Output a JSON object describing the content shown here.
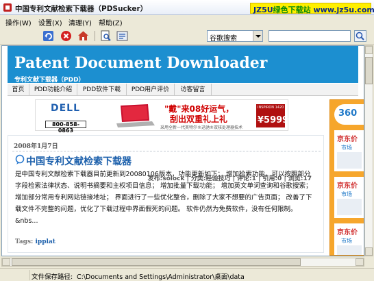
{
  "window": {
    "title": "中国专利文献检索下载器（PDSucker）",
    "watermark_prefix": "JZ5U",
    "watermark_green": "绿色下载站",
    "watermark_url": "www.jz5u.com"
  },
  "menu": [
    {
      "label": "操作(W)"
    },
    {
      "label": "设置(X)"
    },
    {
      "label": "清理(Y)"
    },
    {
      "label": "帮助(Z)"
    }
  ],
  "toolbar": {
    "buttons": [
      {
        "icon": "refresh-icon"
      },
      {
        "icon": "stop-icon"
      },
      {
        "icon": "home-icon"
      },
      {
        "icon": "search-page-icon"
      },
      {
        "icon": "zoom-icon"
      }
    ],
    "search_engine": "谷歌搜索",
    "search_value": "",
    "go_icon": "search-go-icon"
  },
  "page": {
    "site_title": "Patent Document Downloader",
    "site_subtitle": "专利文献下载器（PDD）",
    "nav": [
      "首页",
      "PDD功能介绍",
      "PDD软件下载",
      "PDD用户评价",
      "访客留言"
    ],
    "banner_ad": {
      "brand": "DELL",
      "phone": "800-858-0863",
      "line1": "\"戴\"来08好运气，",
      "line2": "刮出双重礼上礼",
      "line3": "采用全新一代英特尔®迅驰®双核处理器技术",
      "price_tag": "INSPIRON 1420",
      "price": "¥5999"
    },
    "post": {
      "date": "2008年1月7日",
      "title": "中国专利文献检索下载器",
      "body": "是中国专利文献检索下载器目前更新到20080106版本，功能更新如下： 增加检索功能，可以按照部分字段检索法律状态、说明书摘要和主权项目信息； 增加批量下载功能； 增加英文单词查询和谷歌搜索； 增加部分常用专利网站链接地址； 界面进行了一些优化整合，删除了大家不想要的广告页面； 改善了下载文件不完整的问题，优化了下载过程中界面假死的问题。 软件仍然为免费软件，没有任何限制。&nbs...",
      "tags_label": "Tags:",
      "tag": "ipplat",
      "meta": "发布:solock | 分类:经验技巧 | 评论:1 | 引用:0 | 浏览:17"
    },
    "side_ad": {
      "logo": "360",
      "block1_title": "京东价",
      "block1_sub": "市场",
      "block2_title": "京东价",
      "block2_sub": "市场",
      "block3_title": "京东价",
      "block3_sub": "市场"
    }
  },
  "statusbar": {
    "label": "文件保存路径:",
    "path": "C:\\Documents and Settings\\Administrator\\桌面\\data"
  }
}
